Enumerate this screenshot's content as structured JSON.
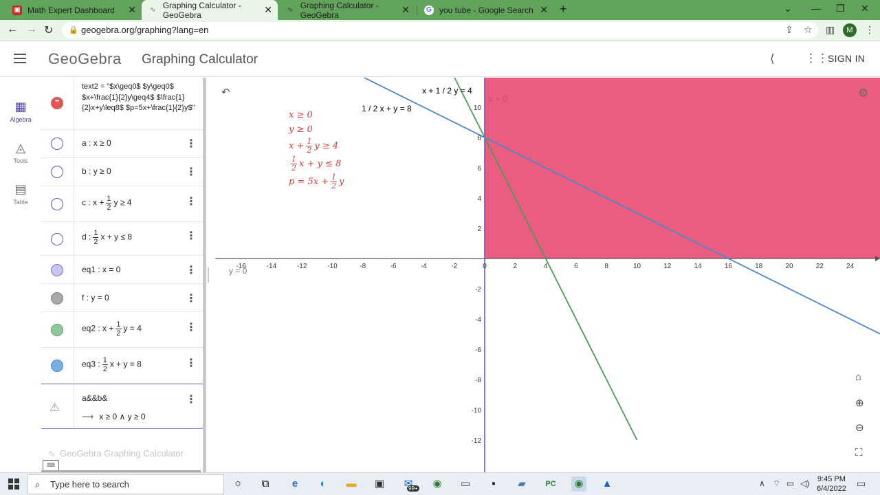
{
  "browser": {
    "tabs": [
      {
        "title": "Math Expert Dashboard",
        "active": false
      },
      {
        "title": "Graphing Calculator - GeoGebra",
        "active": true
      },
      {
        "title": "Graphing Calculator - GeoGebra",
        "active": false
      },
      {
        "title": "you tube - Google Search",
        "active": false
      }
    ],
    "url": "geogebra.org/graphing?lang=en",
    "profile_initial": "M"
  },
  "app": {
    "logo": "GeoGebra",
    "title": "Graphing Calculator",
    "sign_in": "SIGN IN"
  },
  "rail": [
    {
      "label": "Algebra",
      "icon": "calculator-icon",
      "active": true
    },
    {
      "label": "Tools",
      "icon": "tools-icon",
      "active": false
    },
    {
      "label": "Table",
      "icon": "table-icon",
      "active": false
    }
  ],
  "algebra": {
    "text2": "text2 = \"$x\\geq0$ $y\\geq0$ $x+\\frac{1}{2}y\\geq4$ $\\frac{1}{2}x+y\\leq8$ $p=5x+\\frac{1}{2}y$\"",
    "rows": [
      {
        "name": "a",
        "expr": "x ≥ 0"
      },
      {
        "name": "b",
        "expr": "y ≥ 0"
      },
      {
        "name": "c",
        "pre": "x +",
        "num": "1",
        "den": "2",
        "post": "y ≥ 4"
      },
      {
        "name": "d",
        "pre": "",
        "num": "1",
        "den": "2",
        "post": "x + y ≤ 8"
      },
      {
        "name": "eq1",
        "expr": "x = 0"
      },
      {
        "name": "f",
        "expr": "y = 0"
      },
      {
        "name": "eq2",
        "pre": "x +",
        "num": "1",
        "den": "2",
        "post": "y = 4"
      },
      {
        "name": "eq3",
        "pre": "",
        "num": "1",
        "den": "2",
        "post": "x + y = 8"
      }
    ],
    "combo": {
      "title": "a&&b&",
      "result": "x ≥ 0 ∧ y ≥ 0"
    },
    "footer": "GeoGebra Graphing Calculator"
  },
  "graph": {
    "colors": {
      "region": "#e8416a",
      "line_eq2": "#4c9a5a",
      "line_eq3": "#4a88c8",
      "text": "#d53b3b",
      "axis_y": "#6b4cc1"
    },
    "labels": {
      "eq2": "x + 1 / 2 y = 4",
      "eq3": "1 / 2 x + y = 8",
      "eq1": "x = 0",
      "f": "y = 0"
    },
    "x_ticks": [
      -16,
      -14,
      -12,
      -10,
      -8,
      -6,
      -4,
      -2,
      0,
      2,
      4,
      6,
      8,
      10,
      12,
      14,
      16,
      18,
      20,
      22,
      24
    ],
    "y_ticks": [
      10,
      8,
      6,
      4,
      2,
      -2,
      -4,
      -6,
      -8,
      -10,
      -12
    ],
    "text_lines": [
      {
        "type": "plain",
        "text": "x ≥ 0"
      },
      {
        "type": "plain",
        "text": "y ≥ 0"
      },
      {
        "type": "frac",
        "pre": "x +",
        "num": "1",
        "den": "2",
        "post": "y ≥ 4"
      },
      {
        "type": "frac",
        "pre": "",
        "num": "1",
        "den": "2",
        "post": "x + y ≤ 8"
      },
      {
        "type": "frac",
        "pre": "p = 5x +",
        "num": "1",
        "den": "2",
        "post": "y"
      }
    ]
  },
  "taskbar": {
    "search_placeholder": "Type here to search",
    "badge": "99+",
    "time": "9:45 PM",
    "date": "6/4/2022"
  }
}
